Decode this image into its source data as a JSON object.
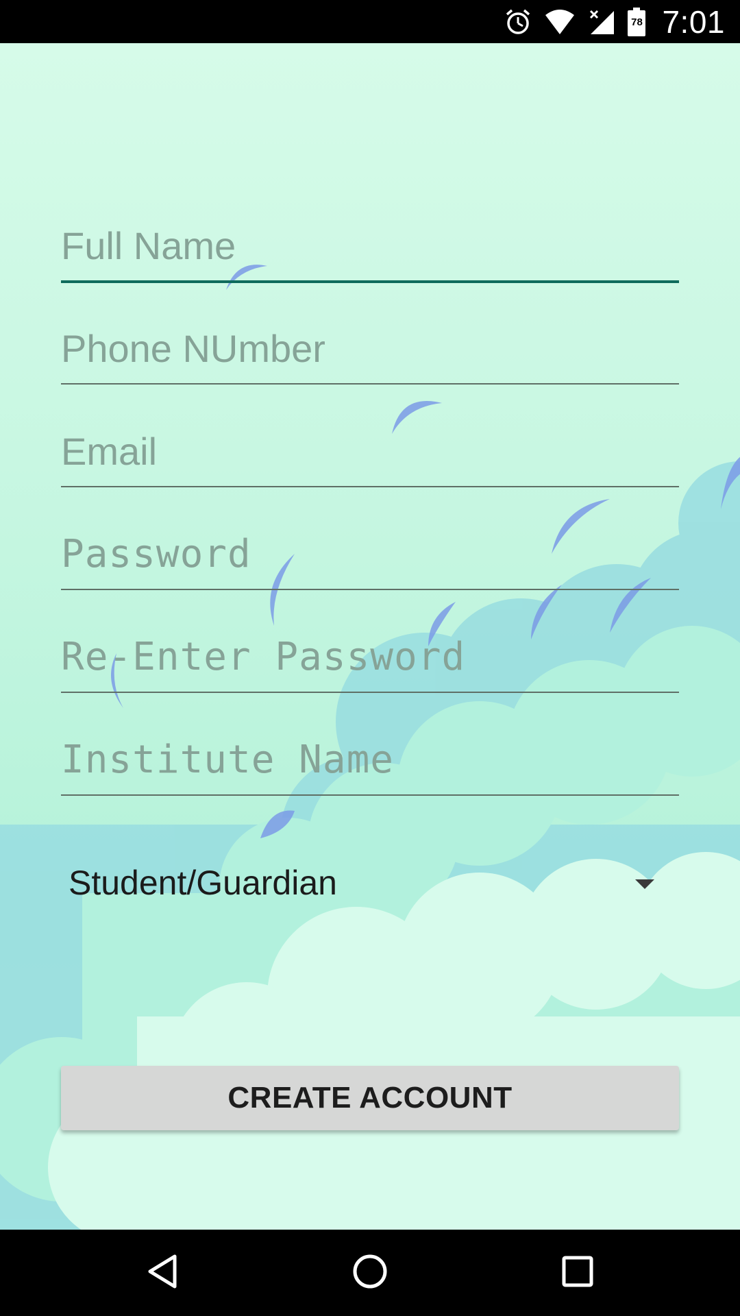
{
  "status_bar": {
    "time": "7:01",
    "battery_level": "78",
    "icons": [
      "alarm-icon",
      "wifi-icon",
      "signal-icon",
      "battery-icon"
    ]
  },
  "form": {
    "full_name_placeholder": "Full Name",
    "phone_placeholder": "Phone NUmber",
    "email_placeholder": "Email",
    "password_placeholder": "Password",
    "reenter_password_placeholder": "Re-Enter Password",
    "institute_placeholder": "Institute Name",
    "user_type_selected": "Student/Guardian"
  },
  "actions": {
    "create_account_label": "CREATE ACCOUNT"
  },
  "nav_bar": {
    "icons": [
      "back-icon",
      "home-icon",
      "recents-icon"
    ]
  },
  "colors": {
    "focused_underline": "#0e6b5c",
    "placeholder_text": "#86a397",
    "button_background": "#d6d7d6",
    "background_top": "#d6fbe9"
  }
}
